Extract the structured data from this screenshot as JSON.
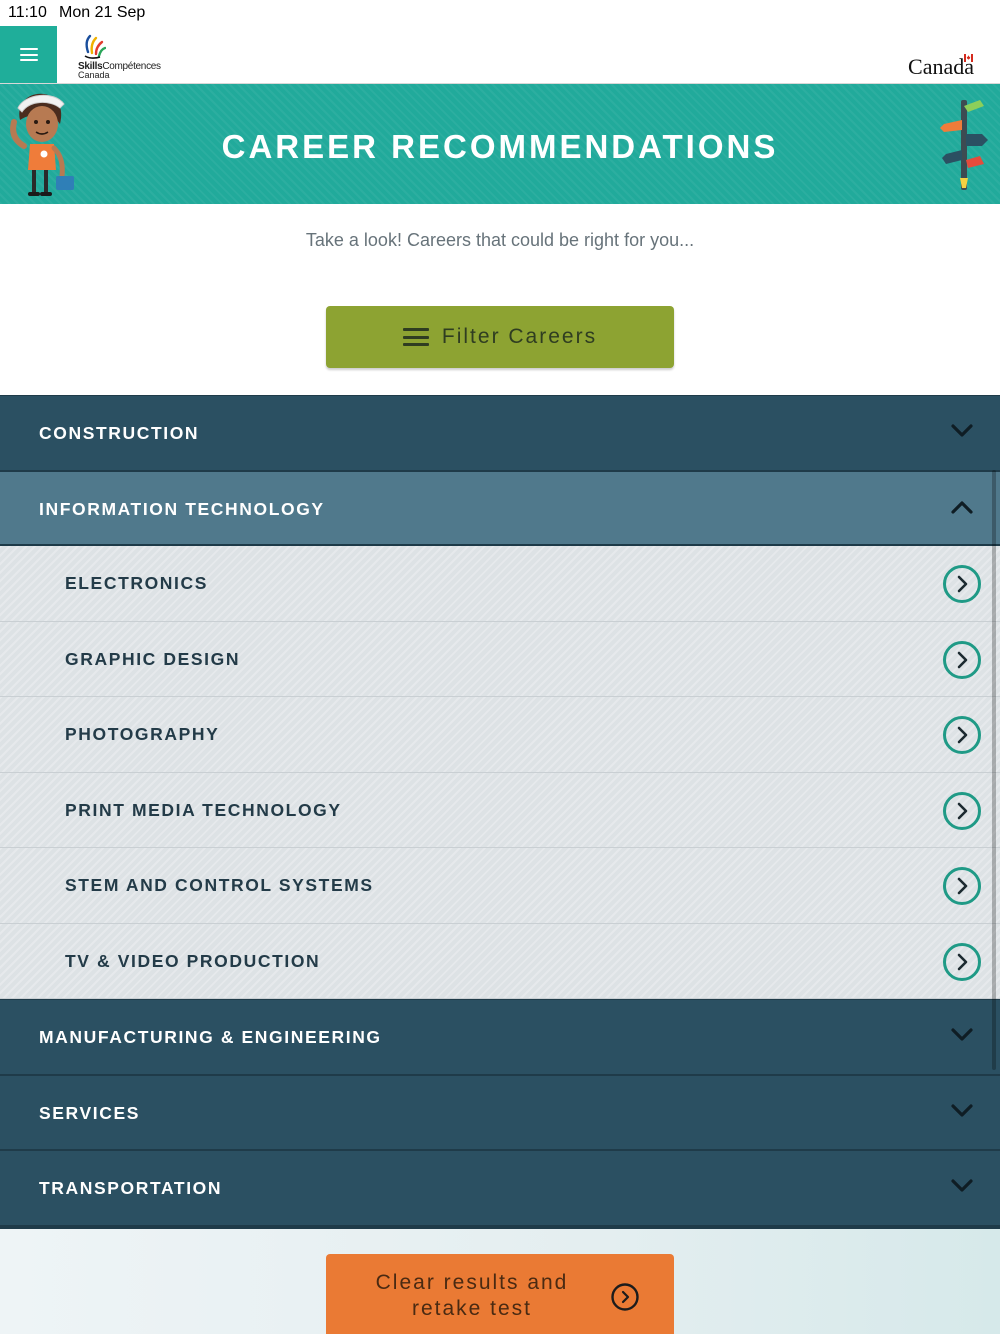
{
  "status_bar": {
    "time": "11:10",
    "date": "Mon 21 Sep"
  },
  "header": {
    "menu_icon": "hamburger-menu-icon",
    "logo_bold": "Skills",
    "logo_rest": "Compétences",
    "logo_line2": "Canada",
    "wordmark": "Canada"
  },
  "banner": {
    "title": "CAREER RECOMMENDATIONS"
  },
  "intro": {
    "text": "Take a look! Careers that could be right for you..."
  },
  "filter": {
    "label": "Filter Careers",
    "color": "#8da332"
  },
  "categories": [
    {
      "label": "CONSTRUCTION",
      "expanded": false
    },
    {
      "label": "INFORMATION TECHNOLOGY",
      "expanded": true,
      "items": [
        "ELECTRONICS",
        "GRAPHIC DESIGN",
        "PHOTOGRAPHY",
        "PRINT MEDIA TECHNOLOGY",
        "STEM AND CONTROL SYSTEMS",
        "TV & VIDEO PRODUCTION"
      ]
    },
    {
      "label": "MANUFACTURING & ENGINEERING",
      "expanded": false
    },
    {
      "label": "SERVICES",
      "expanded": false
    },
    {
      "label": "TRANSPORTATION",
      "expanded": false
    }
  ],
  "retake": {
    "label_line1": "Clear results and",
    "label_line2": "retake test",
    "color": "#ea7a34"
  },
  "colors": {
    "teal": "#21aa9b",
    "category": "#2b5062",
    "category_open": "#50798c",
    "accent_icon": "#1f9a86"
  }
}
